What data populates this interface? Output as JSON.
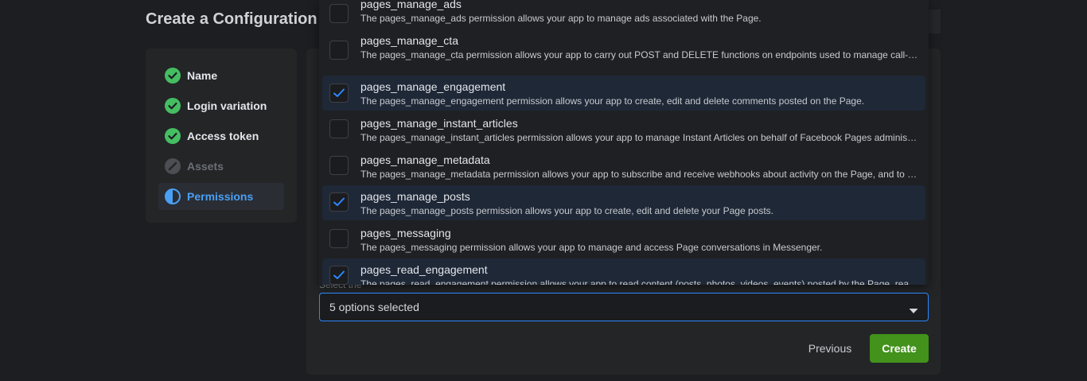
{
  "page": {
    "title": "Create a Configuration"
  },
  "steps": [
    {
      "label": "Name",
      "status": "complete",
      "icon": "check-circle-icon"
    },
    {
      "label": "Login variation",
      "status": "complete",
      "icon": "check-circle-icon"
    },
    {
      "label": "Access token",
      "status": "complete",
      "icon": "check-circle-icon"
    },
    {
      "label": "Assets",
      "status": "disabled",
      "icon": "disabled-circle-icon"
    },
    {
      "label": "Permissions",
      "status": "active",
      "icon": "half-circle-icon"
    }
  ],
  "options": [
    {
      "name": "pages_manage_ads",
      "description": "The pages_manage_ads permission allows your app to manage ads associated with the Page.",
      "checked": false
    },
    {
      "name": "pages_manage_cta",
      "description": "The pages_manage_cta permission allows your app to carry out POST and DELETE functions on endpoints used to manage call-to-action buttons on a Facebook Page.",
      "checked": false
    },
    {
      "name": "pages_manage_engagement",
      "description": "The pages_manage_engagement permission allows your app to create, edit and delete comments posted on the Page.",
      "checked": true
    },
    {
      "name": "pages_manage_instant_articles",
      "description": "The pages_manage_instant_articles permission allows your app to manage Instant Articles on behalf of Facebook Pages administered by people using your app.",
      "checked": false
    },
    {
      "name": "pages_manage_metadata",
      "description": "The pages_manage_metadata permission allows your app to subscribe and receive webhooks about activity on the Page, and to update settings on the Page.",
      "checked": false
    },
    {
      "name": "pages_manage_posts",
      "description": "The pages_manage_posts permission allows your app to create, edit and delete your Page posts.",
      "checked": true
    },
    {
      "name": "pages_messaging",
      "description": "The pages_messaging permission allows your app to manage and access Page conversations in Messenger.",
      "checked": false
    },
    {
      "name": "pages_read_engagement",
      "description": "The pages_read_engagement permission allows your app to read content (posts, photos, videos, events) posted by the Page, read followers data.",
      "checked": true
    }
  ],
  "select": {
    "value": "5 options selected"
  },
  "helper_text": "Select the",
  "buttons": {
    "previous": "Previous",
    "create": "Create"
  },
  "colors": {
    "accent": "#2d88ff",
    "success": "#42921b",
    "check": "#45bd62",
    "active_step": "#4a9ff5"
  }
}
